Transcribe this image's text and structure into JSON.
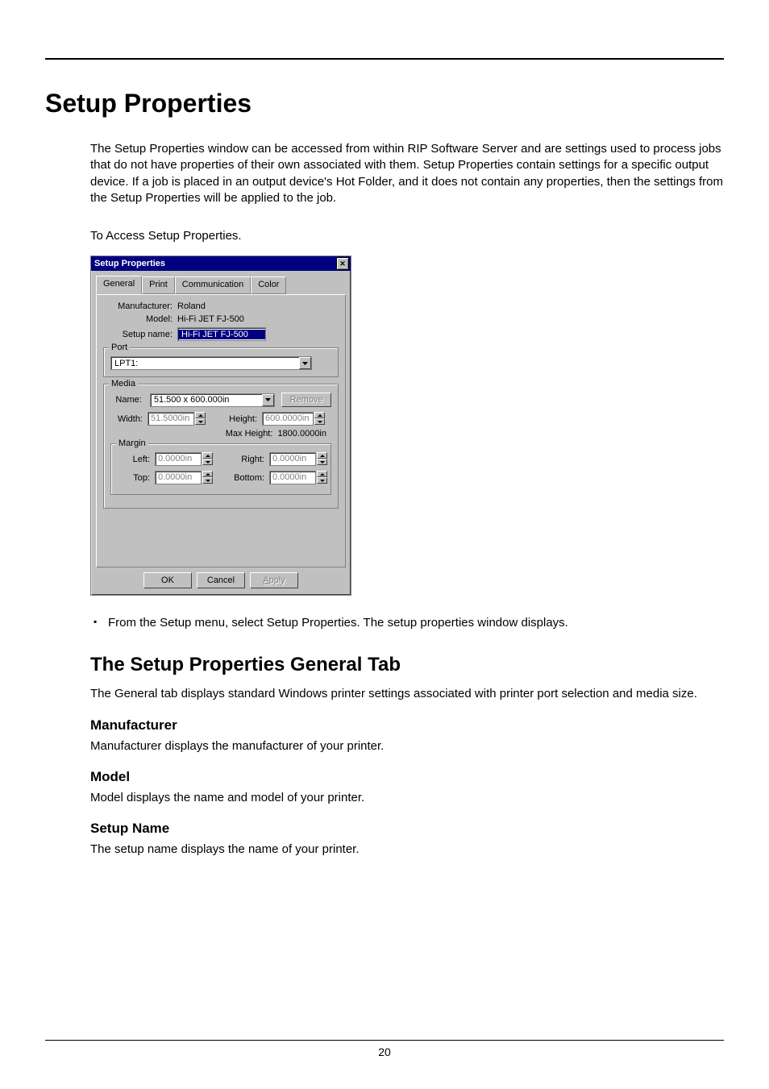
{
  "page": {
    "title": "Setup Properties",
    "intro": "The Setup Properties window can be accessed from within RIP Software Server and are settings used to process jobs that do not have properties of their own associated with them. Setup Properties contain settings for a specific output device. If a job is placed in an output device's Hot Folder, and it does not contain any properties, then the settings from the Setup Properties will be applied to the job.",
    "access_label": "To Access Setup Properties.",
    "bullet": "From the Setup menu, select Setup Properties. The setup properties window displays.",
    "h2": "The Setup Properties General Tab",
    "h2_body": "The General tab displays standard Windows printer settings associated with printer port selection and media size.",
    "sections": {
      "manufacturer": {
        "title": "Manufacturer",
        "body": "Manufacturer displays the manufacturer of your printer."
      },
      "model": {
        "title": "Model",
        "body": "Model displays the name and model of your printer."
      },
      "setup_name": {
        "title": "Setup Name",
        "body": "The setup name displays the name of your printer."
      }
    },
    "page_number": "20"
  },
  "dialog": {
    "title": "Setup Properties",
    "tabs": {
      "general": "General",
      "print": "Print",
      "communication": "Communication",
      "color": "Color"
    },
    "labels": {
      "manufacturer": "Manufacturer:",
      "model": "Model:",
      "setup_name": "Setup name:",
      "port_legend": "Port",
      "media_legend": "Media",
      "media_name": "Name:",
      "width": "Width:",
      "height": "Height:",
      "max_height": "Max Height:",
      "margin_legend": "Margin",
      "left": "Left:",
      "right": "Right:",
      "top": "Top:",
      "bottom": "Bottom:"
    },
    "values": {
      "manufacturer": "Roland",
      "model": "Hi-Fi JET FJ-500",
      "setup_name": "Hi-Fi JET FJ-500",
      "port": "LPT1:",
      "media_name": "51.500 x 600.000in",
      "width": "51.5000in",
      "height": "600.0000in",
      "max_height": "1800.0000in",
      "left": "0.0000in",
      "right": "0.0000in",
      "top": "0.0000in",
      "bottom": "0.0000in"
    },
    "buttons": {
      "remove": "Remove",
      "ok": "OK",
      "cancel": "Cancel",
      "apply_prefix": "A",
      "apply_rest": "pply"
    }
  }
}
